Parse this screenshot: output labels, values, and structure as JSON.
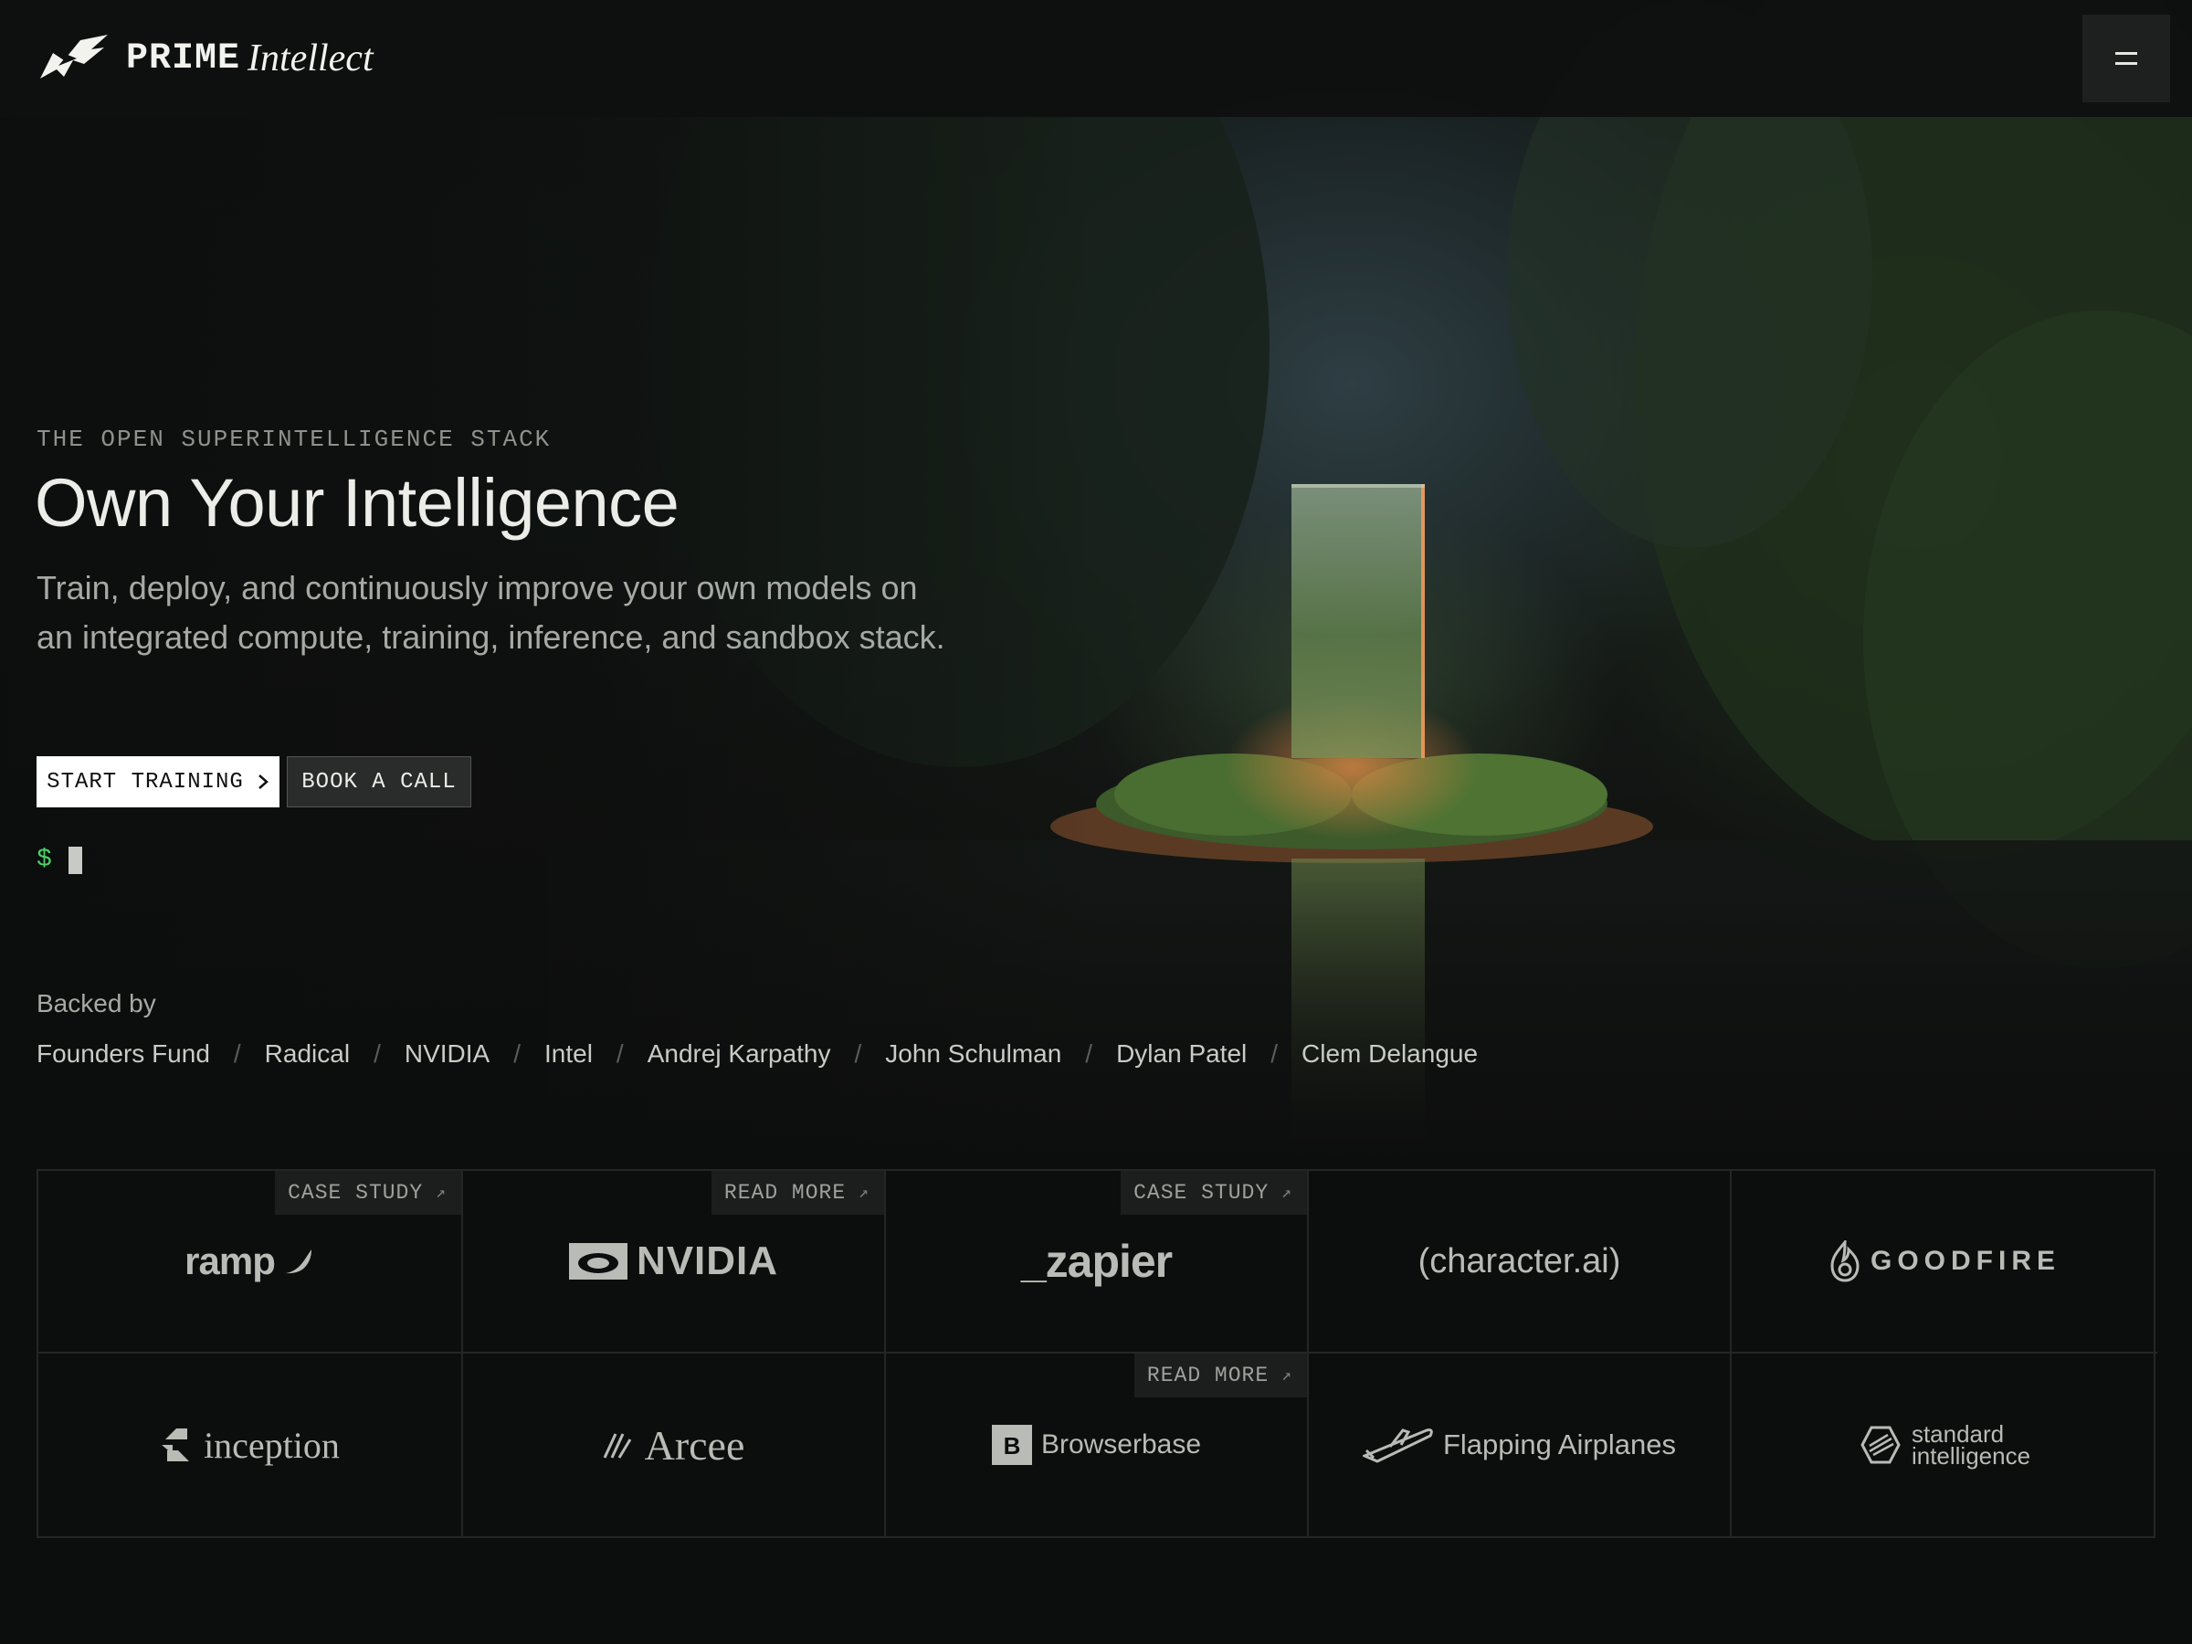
{
  "brand": {
    "prime": "PRIME",
    "intellect": "Intellect"
  },
  "hero": {
    "eyebrow": "THE OPEN SUPERINTELLIGENCE STACK",
    "headline": "Own Your Intelligence",
    "subhead": "Train, deploy, and continuously improve your own models on an integrated compute, training, inference, and sandbox stack.",
    "primary_button": "START TRAINING",
    "secondary_button": "BOOK A CALL",
    "prompt_symbol": "$"
  },
  "backed": {
    "label": "Backed by",
    "names": [
      "Founders Fund",
      "Radical",
      "NVIDIA",
      "Intel",
      "Andrej Karpathy",
      "John Schulman",
      "Dylan Patel",
      "Clem Delangue"
    ],
    "separator": "/"
  },
  "customers": [
    {
      "name": "ramp",
      "tag": "CASE STUDY"
    },
    {
      "name": "NVIDIA",
      "tag": "READ MORE"
    },
    {
      "name": "_zapier",
      "tag": "CASE STUDY"
    },
    {
      "name": "(character.ai)",
      "tag": ""
    },
    {
      "name": "GOODFIRE",
      "tag": ""
    },
    {
      "name": "inception",
      "tag": ""
    },
    {
      "name": "Arcee",
      "tag": ""
    },
    {
      "name": "Browserbase",
      "tag": "READ MORE"
    },
    {
      "name": "Flapping Airplanes",
      "tag": ""
    },
    {
      "name_line1": "standard",
      "name_line2": "intelligence",
      "tag": ""
    }
  ],
  "icons": {
    "menu": "menu-icon",
    "arrow": "chevron-right-icon",
    "external": "arrow-up-right-icon"
  },
  "colors": {
    "background": "#0c0d0d",
    "prompt": "#4cd26a",
    "primary_button_bg": "#ffffff"
  }
}
